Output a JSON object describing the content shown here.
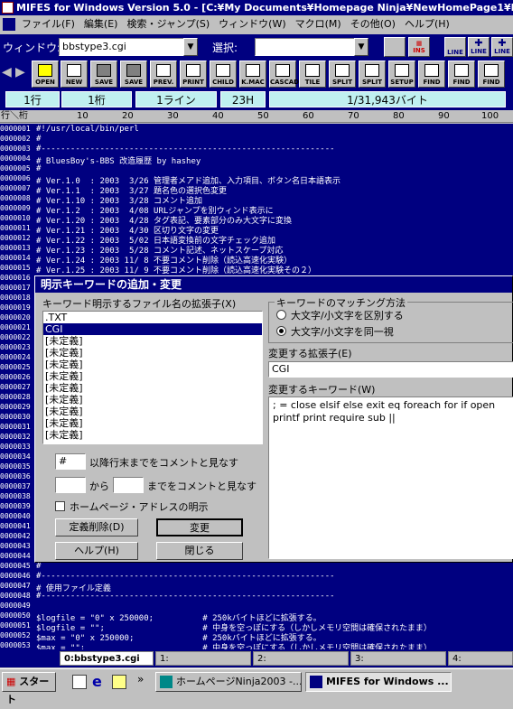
{
  "title": "MIFES for Windows Version 5.0 - [C:¥My Documents¥Homepage Ninja¥NewHomePage1¥HT",
  "menu": [
    "ファイル(F)",
    "編集(E)",
    "検索・ジャンプ(S)",
    "ウィンドウ(W)",
    "マクロ(M)",
    "その他(O)",
    "ヘルプ(H)"
  ],
  "winrow": {
    "window_label": "ウィンドウ:",
    "window_value": "bbstype3.cgi",
    "select_label": "選択:",
    "select_value": "",
    "ins": "INS",
    "line1": "LINE",
    "line2": "LINE",
    "line3": "LINE"
  },
  "toolbar": [
    "OPEN",
    "NEW",
    "SAVE",
    "SAVE",
    "PREV.",
    "PRINT",
    "CHILD",
    "K.MAC",
    "CASCAD",
    "TILE",
    "SPLIT",
    "SPLIT",
    "SETUP",
    "FIND",
    "FIND",
    "FIND"
  ],
  "status": {
    "row": "1行",
    "col": "1桁",
    "line": "1ライン",
    "code": "23H",
    "bytes": "1/31,943バイト"
  },
  "ruler": {
    "corner": "行＼桁",
    "ticks": [
      "10",
      "20",
      "30",
      "40",
      "50",
      "60",
      "70",
      "80",
      "90",
      "100"
    ]
  },
  "lines": [
    {
      "n": "0000001",
      "t": "#!/usr/local/bin/perl"
    },
    {
      "n": "0000002",
      "t": "#"
    },
    {
      "n": "0000003",
      "t": "#------------------------------------------------------------"
    },
    {
      "n": "0000004",
      "t": "# BluesBoy's-BBS 改造履歴 by hashey"
    },
    {
      "n": "0000005",
      "t": "#"
    },
    {
      "n": "0000006",
      "t": "# Ver.1.0  : 2003  3/26 管理者メアド追加、入力項目、ボタン名日本語表示"
    },
    {
      "n": "0000007",
      "t": "# Ver.1.1  : 2003  3/27 題名色の選択色変更"
    },
    {
      "n": "0000008",
      "t": "# Ver.1.10 : 2003  3/28 コメント追加"
    },
    {
      "n": "0000009",
      "t": "# Ver.1.2  : 2003  4/08 URLジャンプを別ウィンド表示に"
    },
    {
      "n": "0000010",
      "t": "# Ver.1.20 : 2003  4/28 タグ表記、要素部分のみ大文字に変換"
    },
    {
      "n": "0000011",
      "t": "# Ver.1.21 : 2003  4/30 区切り文字の変更"
    },
    {
      "n": "0000012",
      "t": "# Ver.1.22 : 2003  5/02 日本語変換前の文字チェック追加"
    },
    {
      "n": "0000013",
      "t": "# Ver.1.23 : 2003  5/28 コメント記述、ネットスケープ対応"
    },
    {
      "n": "0000014",
      "t": "# Ver.1.24 : 2003 11/ 8 不要コメント削除（読込高速化実験）"
    },
    {
      "n": "0000015",
      "t": "# Ver.1.25 : 2003 11/ 9 不要コメント削除（読込高速化実験その２）"
    },
    {
      "n": "0000016",
      "t": ""
    },
    {
      "n": "0000017",
      "t": ""
    },
    {
      "n": "0000018",
      "t": ""
    },
    {
      "n": "0000019",
      "t": ""
    },
    {
      "n": "0000020",
      "t": ""
    },
    {
      "n": "0000021",
      "t": ""
    },
    {
      "n": "0000022",
      "t": ""
    },
    {
      "n": "0000023",
      "t": ""
    },
    {
      "n": "0000024",
      "t": ""
    },
    {
      "n": "0000025",
      "t": ""
    },
    {
      "n": "0000026",
      "t": ""
    },
    {
      "n": "0000027",
      "t": ""
    },
    {
      "n": "0000028",
      "t": ""
    },
    {
      "n": "0000029",
      "t": ""
    },
    {
      "n": "0000030",
      "t": ""
    },
    {
      "n": "0000031",
      "t": ""
    },
    {
      "n": "0000032",
      "t": ""
    },
    {
      "n": "0000033",
      "t": ""
    },
    {
      "n": "0000034",
      "t": ""
    },
    {
      "n": "0000035",
      "t": ""
    },
    {
      "n": "0000036",
      "t": ""
    },
    {
      "n": "0000037",
      "t": ""
    },
    {
      "n": "0000038",
      "t": ""
    },
    {
      "n": "0000039",
      "t": ""
    },
    {
      "n": "0000040",
      "t": ""
    },
    {
      "n": "0000041",
      "t": ""
    },
    {
      "n": "0000042",
      "t": ""
    },
    {
      "n": "0000043",
      "t": ""
    },
    {
      "n": "0000044",
      "t": ""
    },
    {
      "n": "0000045",
      "t": "#"
    },
    {
      "n": "0000046",
      "t": "#------------------------------------------------------------"
    },
    {
      "n": "0000047",
      "t": "# 使用ファイル定義"
    },
    {
      "n": "0000048",
      "t": "#------------------------------------------------------------"
    },
    {
      "n": "0000049",
      "t": ""
    },
    {
      "n": "0000050",
      "t": "$logfile = \"0\" x 250000;          # 250kバイトほどに拡張する。"
    },
    {
      "n": "0000051",
      "t": "$logfile = \"\";                    # 中身を空っぽにする（しかしメモリ空間は確保されたまま）"
    },
    {
      "n": "0000052",
      "t": "$max = \"0\" x 250000;              # 250kバイトほどに拡張する。"
    },
    {
      "n": "0000053",
      "t": "$max = \"\";                        # 中身を空っぽにする（しかしメモリ空間は確保されたまま）"
    }
  ],
  "dialog": {
    "title": "明示キーワードの追加・変更",
    "ext_list_label": "キーワード明示するファイル名の拡張子(X)",
    "ext_items": [
      ".TXT",
      "CGI",
      "[未定義]",
      "[未定義]",
      "[未定義]",
      "[未定義]",
      "[未定義]",
      "[未定義]",
      "[未定義]",
      "[未定義]",
      "[未定義]"
    ],
    "selected_index": 1,
    "match_group": "キーワードのマッチング方法",
    "match_opt1": "大文字/小文字を区別する",
    "match_opt2": "大文字/小文字を同一視",
    "ext_change_label": "変更する拡張子(E)",
    "ext_change_value": "CGI",
    "keyword_label": "変更するキーワード(W)",
    "keyword_text": "; = close elsif else exit eq foreach for if open printf print require sub ||",
    "comment_char": "#",
    "comment_label": "以降行末までをコメントと見なす",
    "from_label": "から",
    "to_label": "までをコメントと見なす",
    "homepage_label": "ホームページ・アドレスの明示",
    "btn_delete": "定義削除(D)",
    "btn_change": "変更",
    "btn_help": "ヘルプ(H)",
    "btn_close": "閉じる"
  },
  "tabs": [
    "0:bbstype3.cgi",
    "1:",
    "2:",
    "3:",
    "4:"
  ],
  "taskbar": {
    "start": "スタート",
    "task1": "ホームページNinja2003 -...",
    "task2": "MIFES for Windows ..."
  }
}
